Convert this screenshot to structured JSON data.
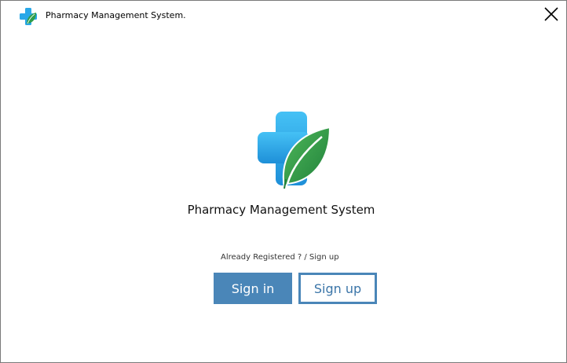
{
  "window": {
    "title": "Pharmacy Management System.",
    "close_glyph": "✕"
  },
  "main": {
    "app_name": "Pharmacy Management System",
    "prompt": "Already Registered ? / Sign up",
    "signin_label": "Sign in",
    "signup_label": "Sign up"
  },
  "icons": {
    "app_icon": "cross-leaf-logo-icon",
    "close": "close-icon"
  },
  "colors": {
    "accent": "#4a86b8",
    "cross_blue": "#29a8e8",
    "leaf_green": "#2f9e4a"
  }
}
